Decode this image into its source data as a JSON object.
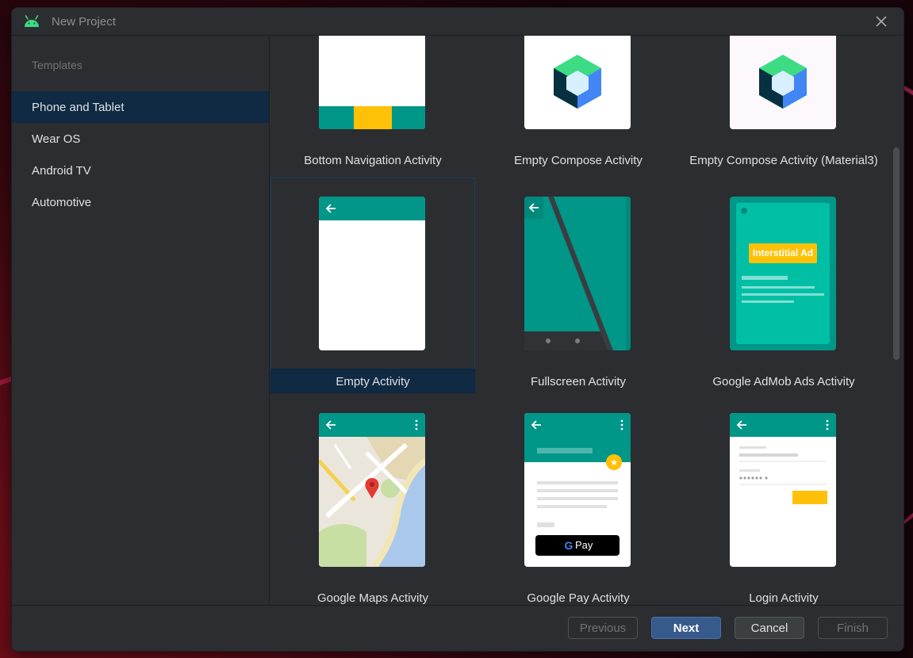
{
  "window": {
    "title": "New Project"
  },
  "sidebar": {
    "header": "Templates",
    "items": [
      {
        "label": "Phone and Tablet",
        "selected": true
      },
      {
        "label": "Wear OS",
        "selected": false
      },
      {
        "label": "Android TV",
        "selected": false
      },
      {
        "label": "Automotive",
        "selected": false
      }
    ]
  },
  "templates": [
    {
      "label": "Bottom Navigation Activity",
      "selected": false
    },
    {
      "label": "Empty Compose Activity",
      "selected": false
    },
    {
      "label": "Empty Compose Activity (Material3)",
      "selected": false
    },
    {
      "label": "Empty Activity",
      "selected": true
    },
    {
      "label": "Fullscreen Activity",
      "selected": false
    },
    {
      "label": "Google AdMob Ads Activity",
      "selected": false,
      "banner_text": "Interstitial Ad"
    },
    {
      "label": "Google Maps Activity",
      "selected": false
    },
    {
      "label": "Google Pay Activity",
      "selected": false,
      "pay_text": "Pay"
    },
    {
      "label": "Login Activity",
      "selected": false
    }
  ],
  "footer": {
    "previous_label": "Previous",
    "next_label": "Next",
    "cancel_label": "Cancel",
    "finish_label": "Finish"
  },
  "colors": {
    "teal": "#009688",
    "teal_dark": "#00796b",
    "amber": "#ffc107",
    "selection": "#0f2a42",
    "primary_button": "#375a8c"
  }
}
